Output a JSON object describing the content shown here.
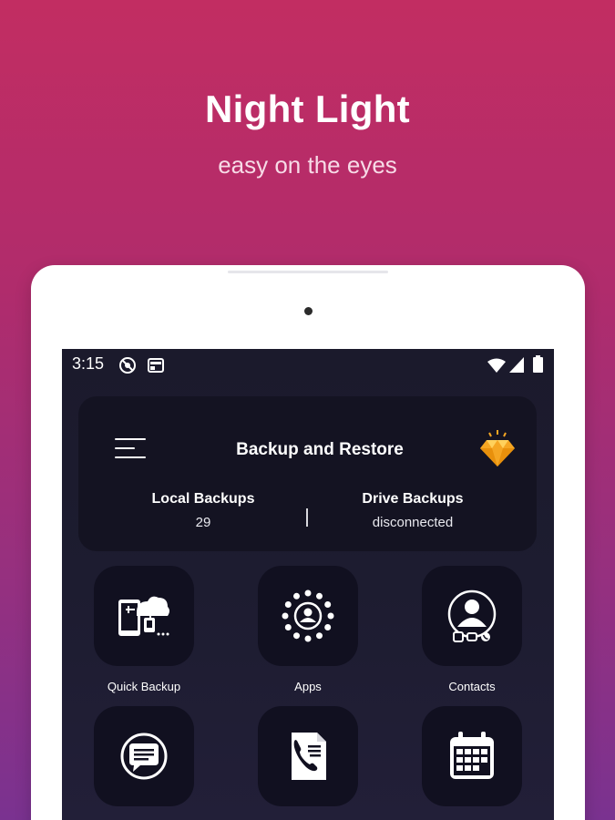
{
  "promo": {
    "title": "Night Light",
    "subtitle": "easy on the eyes"
  },
  "status_bar": {
    "time": "3:15",
    "left_icons": [
      "do-not-disturb-icon",
      "notification-card-icon"
    ],
    "right_icons": [
      "wifi-icon",
      "cell-signal-icon",
      "battery-icon"
    ]
  },
  "header": {
    "title": "Backup and Restore",
    "menu_icon": "hamburger-menu-icon",
    "premium_icon": "diamond-premium-icon",
    "local": {
      "label": "Local Backups",
      "value": "29"
    },
    "drive": {
      "label": "Drive Backups",
      "value": "disconnected"
    }
  },
  "tiles": [
    {
      "label": "Quick Backup",
      "icon": "quick-backup-icon"
    },
    {
      "label": "Apps",
      "icon": "apps-icon"
    },
    {
      "label": "Contacts",
      "icon": "contacts-icon"
    },
    {
      "label": "",
      "icon": "messages-icon"
    },
    {
      "label": "",
      "icon": "call-logs-icon"
    },
    {
      "label": "",
      "icon": "calendar-icon"
    }
  ],
  "colors": {
    "background_top": "#c22d62",
    "background_bottom": "#7a3290",
    "screen_bg": "#1b1a2c",
    "card_bg": "#141322",
    "tile_bg": "#111020",
    "premium_gold": "#f5a623"
  }
}
